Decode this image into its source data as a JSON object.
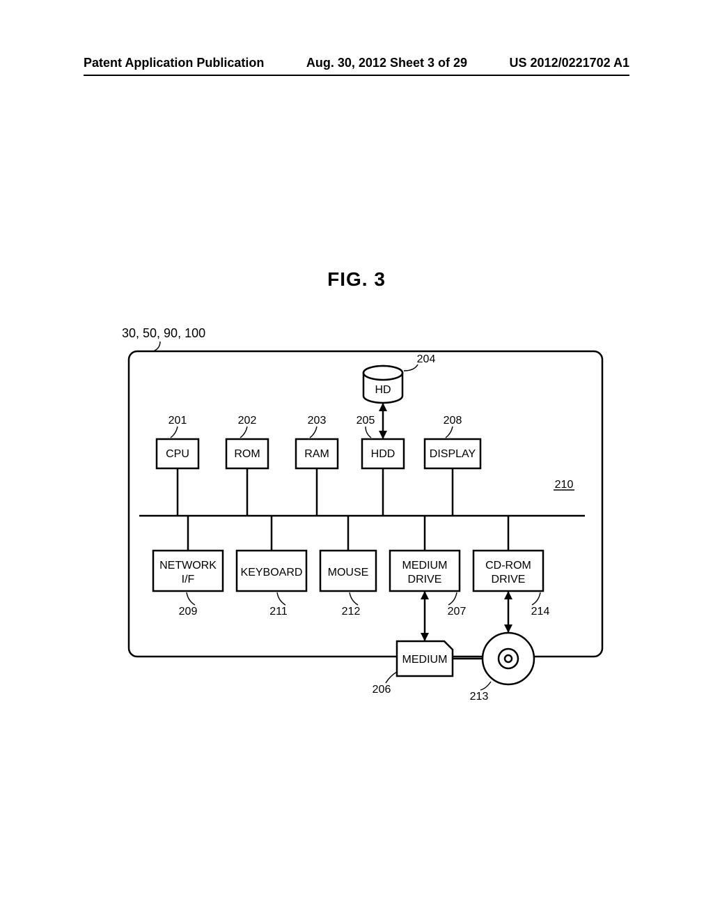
{
  "header": {
    "left": "Patent Application Publication",
    "center": "Aug. 30, 2012  Sheet 3 of 29",
    "right": "US 2012/0221702 A1"
  },
  "figure": {
    "title": "FIG. 3",
    "ref_group": "30, 50, 90, 100"
  },
  "labels": {
    "n201": "201",
    "n202": "202",
    "n203": "203",
    "n204": "204",
    "n205": "205",
    "n206": "206",
    "n207": "207",
    "n208": "208",
    "n209": "209",
    "n210": "210",
    "n211": "211",
    "n212": "212",
    "n213": "213",
    "n214": "214"
  },
  "blocks": {
    "cpu": "CPU",
    "rom": "ROM",
    "ram": "RAM",
    "hd": "HD",
    "hdd": "HDD",
    "display": "DISPLAY",
    "network_if_1": "NETWORK",
    "network_if_2": "I/F",
    "keyboard": "KEYBOARD",
    "mouse": "MOUSE",
    "medium_drive_1": "MEDIUM",
    "medium_drive_2": "DRIVE",
    "cdrom_drive_1": "CD-ROM",
    "cdrom_drive_2": "DRIVE",
    "medium": "MEDIUM"
  }
}
